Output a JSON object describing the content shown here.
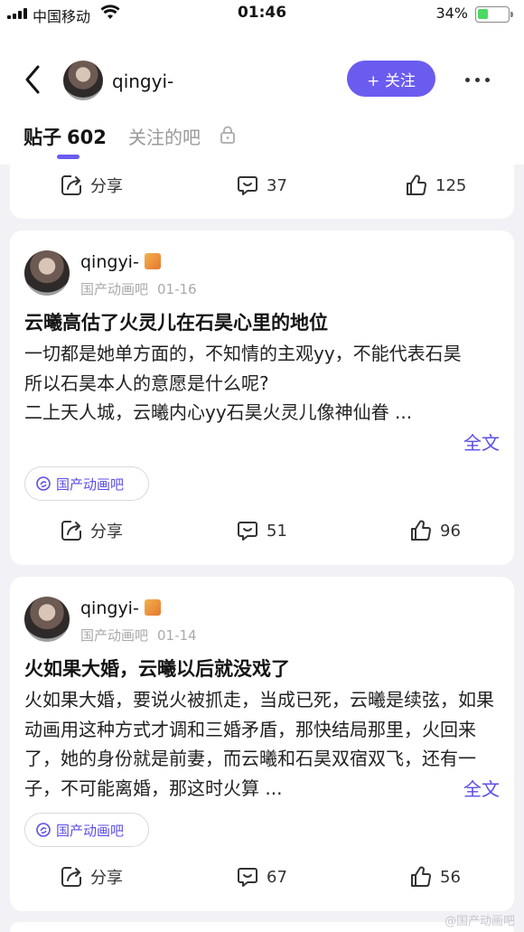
{
  "status_bar": {
    "carrier": "中国移动",
    "time": "01:46",
    "battery": "34%",
    "battery_level": 0.34
  },
  "header": {
    "username": "qingyi-",
    "follow_label": "+ 关注",
    "tabs": [
      {
        "label": "贴子",
        "count": "602"
      },
      {
        "label": "关注的吧"
      }
    ]
  },
  "partial_card": {
    "share": "分享",
    "comments": "37",
    "likes": "125"
  },
  "posts": [
    {
      "author": "qingyi-",
      "forum": "国产动画吧",
      "date": "01-16",
      "title": "云曦高估了火灵儿在石昊心里的地位",
      "body_lines": [
        "一切都是她单方面的，不知情的主观yy，不能代表石昊",
        "所以石昊本人的意愿是什么呢?",
        "二上天人城，云曦内心yy石昊火灵儿像神仙眷 ..."
      ],
      "more": "全文",
      "tag": "国产动画吧",
      "share": "分享",
      "comments": "51",
      "likes": "96"
    },
    {
      "author": "qingyi-",
      "forum": "国产动画吧",
      "date": "01-14",
      "title": "火如果大婚，云曦以后就没戏了",
      "body_lines": [
        "火如果大婚，要说火被抓走，当成已死，云曦是续弦，如果动画用这种方式才调和三婚矛盾，那快结局那里，火回来了，她的身份就是前妻，而云曦和石昊双宿双飞，还有一子，不可能离婚，那这时火算 ..."
      ],
      "more": "全文",
      "tag": "国产动画吧",
      "share": "分享",
      "comments": "67",
      "likes": "56"
    }
  ],
  "watermark": "@国产动画吧",
  "colors": {
    "accent": "#6b5cf0",
    "link": "#5b4ee6",
    "background": "#f2f2f6"
  }
}
